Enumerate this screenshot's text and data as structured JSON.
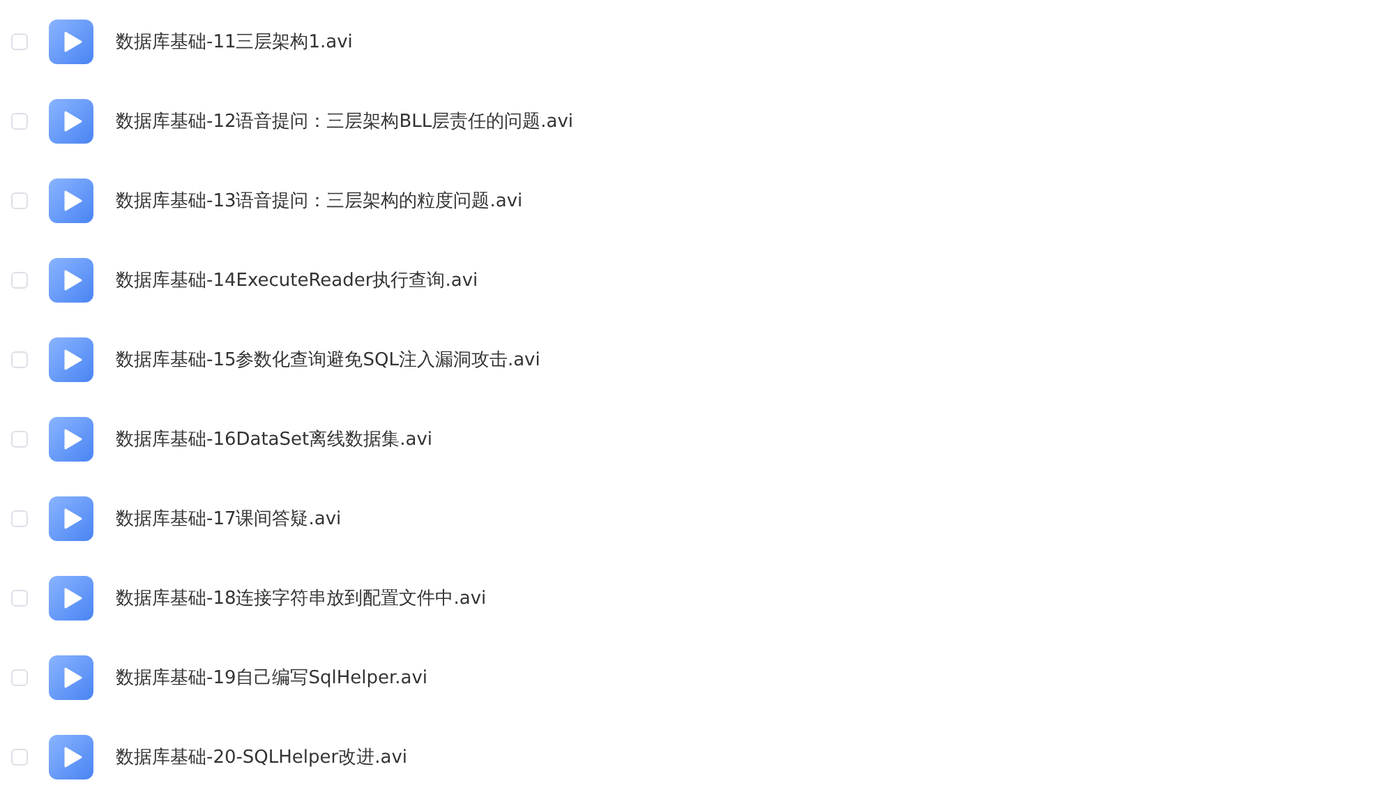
{
  "files": [
    {
      "name": "数据库基础-11三层架构1.avi",
      "checked": false
    },
    {
      "name": "数据库基础-12语音提问：三层架构BLL层责任的问题.avi",
      "checked": false
    },
    {
      "name": "数据库基础-13语音提问：三层架构的粒度问题.avi",
      "checked": false
    },
    {
      "name": "数据库基础-14ExecuteReader执行查询.avi",
      "checked": false
    },
    {
      "name": "数据库基础-15参数化查询避免SQL注入漏洞攻击.avi",
      "checked": false
    },
    {
      "name": "数据库基础-16DataSet离线数据集.avi",
      "checked": false
    },
    {
      "name": "数据库基础-17课间答疑.avi",
      "checked": false
    },
    {
      "name": "数据库基础-18连接字符串放到配置文件中.avi",
      "checked": false
    },
    {
      "name": "数据库基础-19自己编写SqlHelper.avi",
      "checked": false
    },
    {
      "name": "数据库基础-20-SQLHelper改进.avi",
      "checked": false
    }
  ]
}
